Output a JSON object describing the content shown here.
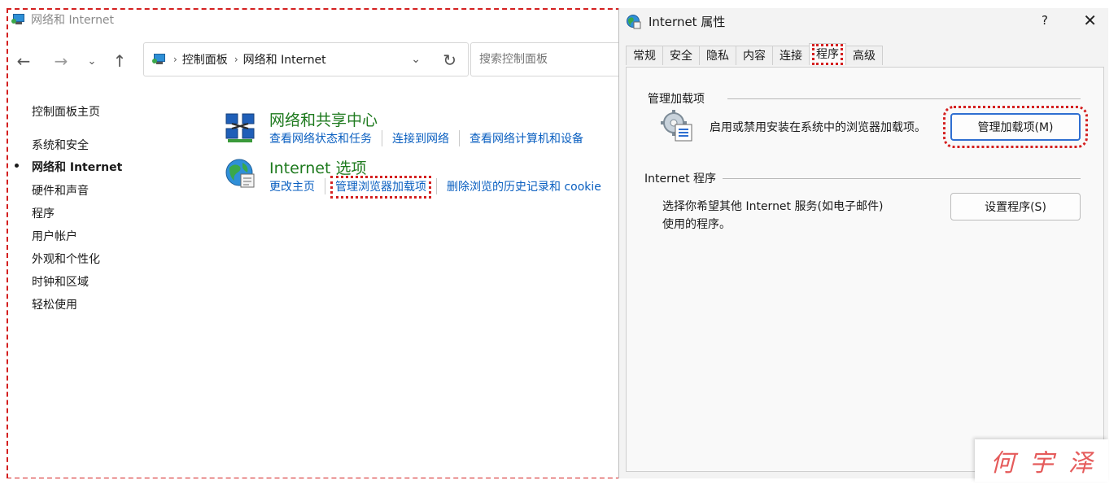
{
  "control_panel": {
    "window_title": "网络和 Internet",
    "address": {
      "crumb_1": "控制面板",
      "crumb_2": "网络和 Internet"
    },
    "search_placeholder": "搜索控制面板",
    "sidebar": {
      "home": "控制面板主页",
      "items": [
        "系统和安全",
        "网络和 Internet",
        "硬件和声音",
        "程序",
        "用户帐户",
        "外观和个性化",
        "时钟和区域",
        "轻松使用"
      ]
    },
    "categories": [
      {
        "title": "网络和共享中心",
        "icon": "network-sharing-icon",
        "links": [
          "查看网络状态和任务",
          "连接到网络",
          "查看网络计算机和设备"
        ]
      },
      {
        "title": "Internet 选项",
        "icon": "internet-globe-icon",
        "links": [
          "更改主页",
          "管理浏览器加载项",
          "删除浏览的历史记录和 cookie"
        ]
      }
    ]
  },
  "dialog": {
    "title": "Internet 属性",
    "help": "?",
    "close": "✕",
    "tabs": [
      "常规",
      "安全",
      "隐私",
      "内容",
      "连接",
      "程序",
      "高级"
    ],
    "selected_tab": "程序",
    "addons_group": {
      "label": "管理加载项",
      "description": "启用或禁用安装在系统中的浏览器加载项。",
      "button": "管理加载项(M)"
    },
    "programs_group": {
      "label": "Internet 程序",
      "description_line1": "选择你希望其他 Internet 服务(如电子邮件)",
      "description_line2": "使用的程序。",
      "button": "设置程序(S)"
    }
  },
  "watermark": [
    "何",
    "宇",
    "泽"
  ],
  "colors": {
    "link": "#0a5fc0",
    "category_title": "#1e7a1e",
    "highlight": "#d42020",
    "primary_border": "#2f6fd1"
  }
}
